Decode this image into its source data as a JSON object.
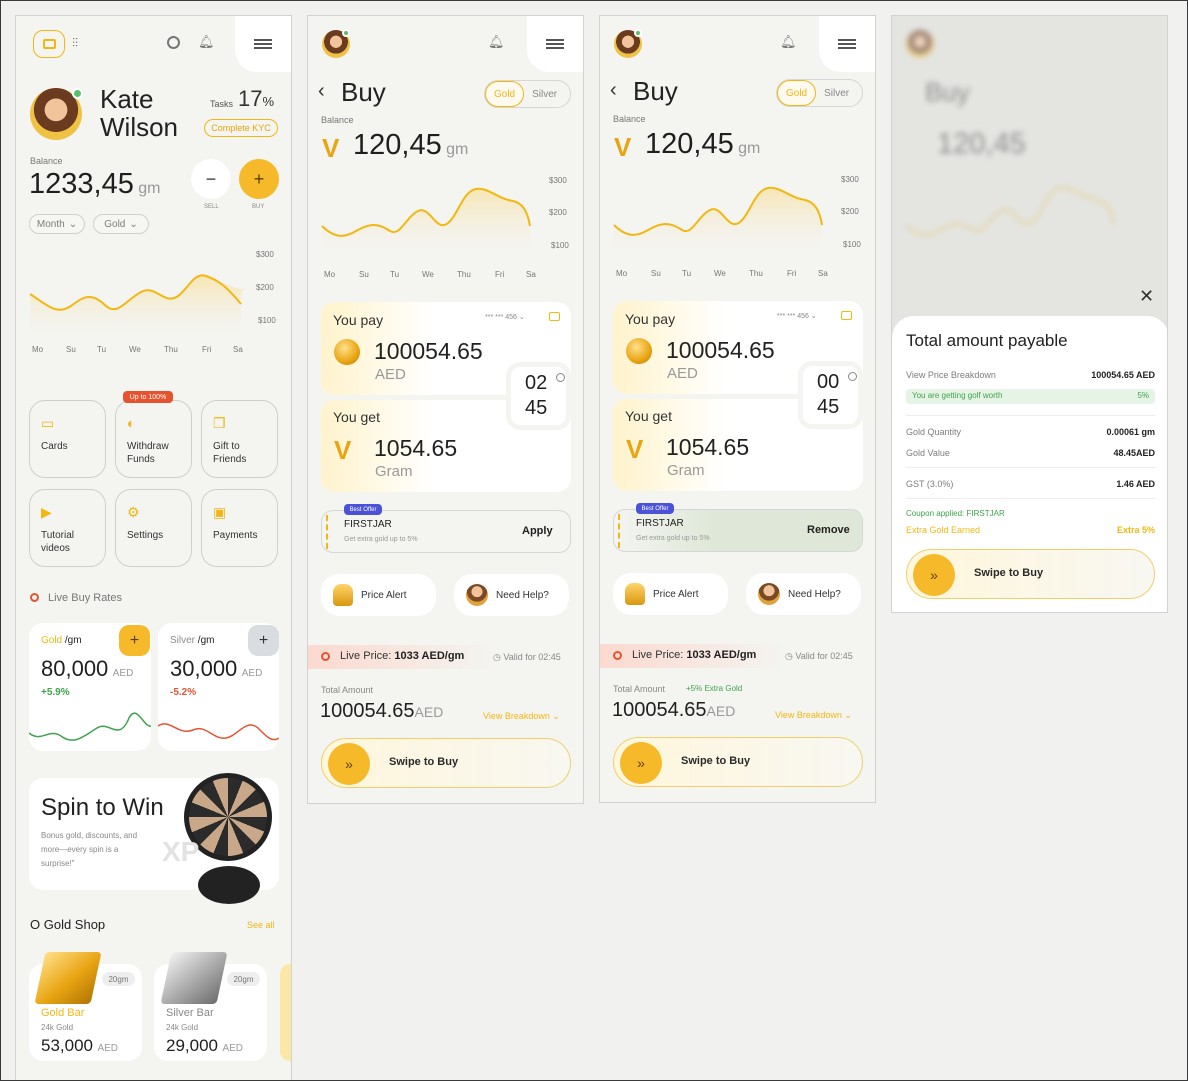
{
  "colors": {
    "accent": "#f2b713",
    "positive": "#3fa34d",
    "negative": "#e5542f",
    "background": "#f4f4f1"
  },
  "screen1": {
    "user": {
      "first": "Kate",
      "last": "Wilson"
    },
    "tasks": {
      "label": "Tasks",
      "value": "17",
      "unit": "%"
    },
    "kyc_button": "Complete KYC",
    "balance": {
      "label": "Balance",
      "value": "1233,45",
      "unit": "gm"
    },
    "sell_label": "SELL",
    "buy_label": "BUY",
    "filter_period": "Month",
    "filter_metal": "Gold",
    "chart_y": [
      "$300",
      "$200",
      "$100"
    ],
    "chart_x": [
      "Mo",
      "Su",
      "Tu",
      "We",
      "Thu",
      "Fri",
      "Sa"
    ],
    "promo_badge": "Up to 100%",
    "tiles": [
      {
        "icon": "card-icon",
        "label_1": "Cards",
        "label_2": ""
      },
      {
        "icon": "hand-coin-icon",
        "label_1": "Withdraw",
        "label_2": "Funds"
      },
      {
        "icon": "gift-icon",
        "label_1": "Gift to",
        "label_2": "Friends"
      },
      {
        "icon": "video-icon",
        "label_1": "Tutorial",
        "label_2": "videos"
      },
      {
        "icon": "gear-icon",
        "label_1": "Settings",
        "label_2": ""
      },
      {
        "icon": "payment-icon",
        "label_1": "Payments",
        "label_2": ""
      }
    ],
    "live_rates_title": "Live Buy Rates",
    "gold_rate": {
      "name": "Gold",
      "unit": "/gm",
      "value": "80,000",
      "currency": "AED",
      "change": "+5.9%"
    },
    "silver_rate": {
      "name": "Silver",
      "unit": "/gm",
      "value": "30,000",
      "currency": "AED",
      "change": "-5.2%"
    },
    "spin": {
      "title": "Spin to Win",
      "text_1": "Bonus gold, discounts, and",
      "text_2": "more—every spin is a",
      "text_3": "surprise!\"",
      "xp": "XP"
    },
    "shop_title": "O Gold Shop",
    "see_all": "See all",
    "products": [
      {
        "weight": "20gm",
        "name": "Gold Bar",
        "purity": "24k Gold",
        "price": "53,000",
        "currency": "AED"
      },
      {
        "weight": "20gm",
        "name": "Silver Bar",
        "purity": "24k Gold",
        "price": "29,000",
        "currency": "AED"
      }
    ]
  },
  "buy": {
    "title": "Buy",
    "tab_gold": "Gold",
    "tab_silver": "Silver",
    "balance_label": "Balance",
    "balance_value": "120,45",
    "balance_unit": "gm",
    "chart_y": [
      "$300",
      "$200",
      "$100"
    ],
    "chart_x": [
      "Mo",
      "Su",
      "Tu",
      "We",
      "Thu",
      "Fri",
      "Sa"
    ],
    "you_pay": "You pay",
    "card_mask": "*** *** 456",
    "pay_amount": "100054.65",
    "pay_currency": "AED",
    "you_get": "You get",
    "get_amount": "1054.65",
    "get_unit": "Gram",
    "best_offer": "Best Offer",
    "coupon": "FIRSTJAR",
    "coupon_text": "Get extra gold up to 5%",
    "apply": "Apply",
    "remove": "Remove",
    "price_alert": "Price Alert",
    "need_help": "Need Help?",
    "live_price_label": "Live Price:",
    "live_price_value": "1033 AED/gm",
    "valid_for": "Valid for 02:45",
    "total_label": "Total Amount",
    "extra_gold": "+5% Extra Gold",
    "total_value": "100054.65",
    "total_currency": "AED",
    "view_breakdown": "View Breakdown",
    "swipe": "Swipe to Buy",
    "timer_a": [
      "02",
      "45"
    ],
    "timer_b": [
      "00",
      "45"
    ]
  },
  "sheet": {
    "title": "Total amount payable",
    "breakdown_label": "View Price Breakdown",
    "breakdown_value": "100054.65 AED",
    "worth_label": "You are getting golf worth",
    "worth_value": "5%",
    "qty_label": "Gold Quantity",
    "qty_value": "0.00061 gm",
    "gold_value_label": "Gold Value",
    "gold_value": "48.45AED",
    "gst_label": "GST (3.0%)",
    "gst_value": "1.46 AED",
    "coupon_applied": "Coupon applied: FIRSTJAR",
    "extra_label": "Extra Gold Earned",
    "extra_value": "Extra 5%",
    "swipe": "Swipe to Buy"
  }
}
